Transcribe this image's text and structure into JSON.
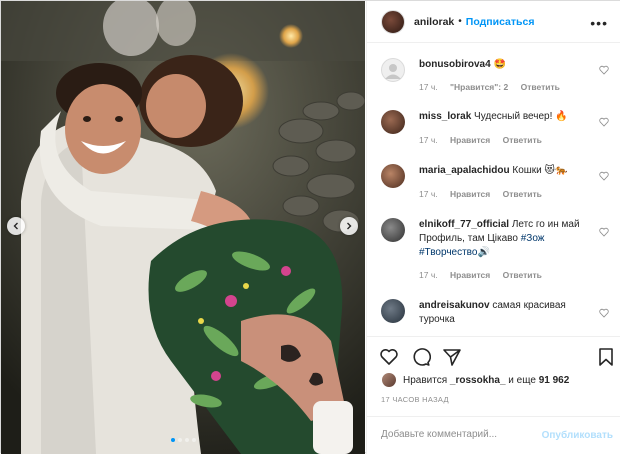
{
  "header": {
    "username": "anilorak",
    "separator": "•",
    "follow_label": "Подписаться",
    "more_icon": "ellipsis-icon"
  },
  "comments": [
    {
      "username": "bonusobirova4",
      "text": "🤩",
      "time": "17 ч.",
      "likes": "\"Нравится\": 2",
      "reply": "Ответить"
    },
    {
      "username": "miss_lorak",
      "text": "Чудесный вечер! 🔥",
      "time": "17 ч.",
      "likes": "Нравится",
      "reply": "Ответить"
    },
    {
      "username": "maria_apalachidou",
      "text": "Кошки 😻🐅",
      "time": "17 ч.",
      "likes": "Нравится",
      "reply": "Ответить"
    },
    {
      "username": "elnikoff_77_official",
      "text": "Летс го ин май Профиль, там Цікаво",
      "tag1": "#Зож",
      "tag2": "#Творчество",
      "emoji": "🔊",
      "time": "17 ч.",
      "likes": "Нравится",
      "reply": "Ответить"
    },
    {
      "username": "andreisakunov",
      "text": "самая красивая турочка",
      "time": "",
      "likes": "",
      "reply": ""
    }
  ],
  "likes": {
    "prefix": "Нравится",
    "user": "_rossokha_",
    "middle": "и еще",
    "count": "91 962"
  },
  "timestamp": "17 ЧАСОВ НАЗАД",
  "add_comment": {
    "placeholder": "Добавьте комментарий...",
    "publish_label": "Опубликовать"
  },
  "carousel": {
    "dots": 4,
    "active_dot": 1
  },
  "colors": {
    "accent": "#0095f6",
    "muted": "#8e8e8e",
    "hashtag": "#00376b",
    "publish_disabled": "#b2dffc"
  }
}
